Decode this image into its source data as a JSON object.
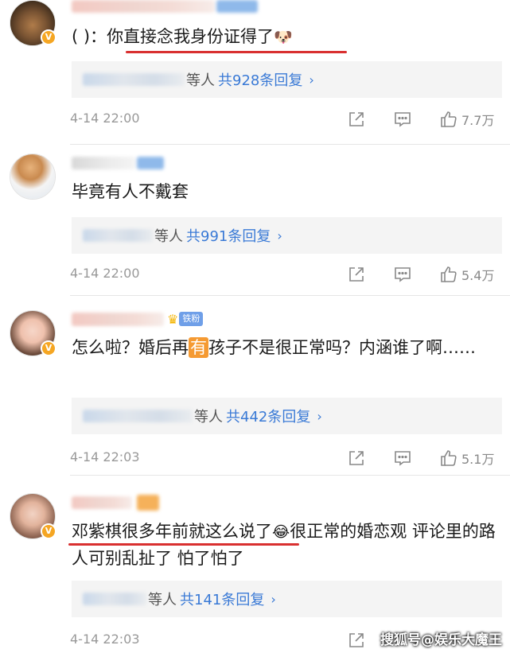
{
  "comments": [
    {
      "text_prefix": "( )：",
      "text_main": "你直接念我身份证得了",
      "text_emoji": "🐶",
      "replies_suffix": "等人",
      "replies_count": "共928条回复",
      "chevron": "›",
      "timestamp": "4-14 22:00",
      "likes": "7.7万"
    },
    {
      "text": "毕竟有人不戴套",
      "replies_suffix": "等人",
      "replies_count": "共991条回复",
      "chevron": "›",
      "timestamp": "4-14 22:00",
      "likes": "5.4万"
    },
    {
      "fan_badge": "铁粉",
      "text_a": "怎么啦？婚后再",
      "text_highlight": "有",
      "text_b": "孩子不是很正常吗？内涵谁了啊……",
      "replies_suffix": "等人",
      "replies_count": "共442条回复",
      "chevron": "›",
      "timestamp": "4-14 22:03",
      "likes": "5.1万"
    },
    {
      "text_a": "邓紫棋很多年前就这么说了",
      "text_emoji": "😂",
      "text_b": "很正常的婚恋观 评论里的路人可别乱扯了 怕了怕了",
      "replies_suffix": "等人",
      "replies_count": "共141条回复",
      "chevron": "›",
      "timestamp": "4-14 22:03"
    }
  ],
  "icons": {
    "share": "share-icon",
    "comment": "comment-icon",
    "like": "thumbs-up-icon",
    "verified": "verified-badge-icon",
    "crown": "crown-icon"
  },
  "colors": {
    "link_blue": "#3a7ad6",
    "underline_red": "#d93030",
    "badge_orange": "#f5a623",
    "fan_badge_blue": "#6f9fe8",
    "highlight_orange": "#f59a32"
  },
  "watermark": "搜狐号@娱乐大魔王"
}
